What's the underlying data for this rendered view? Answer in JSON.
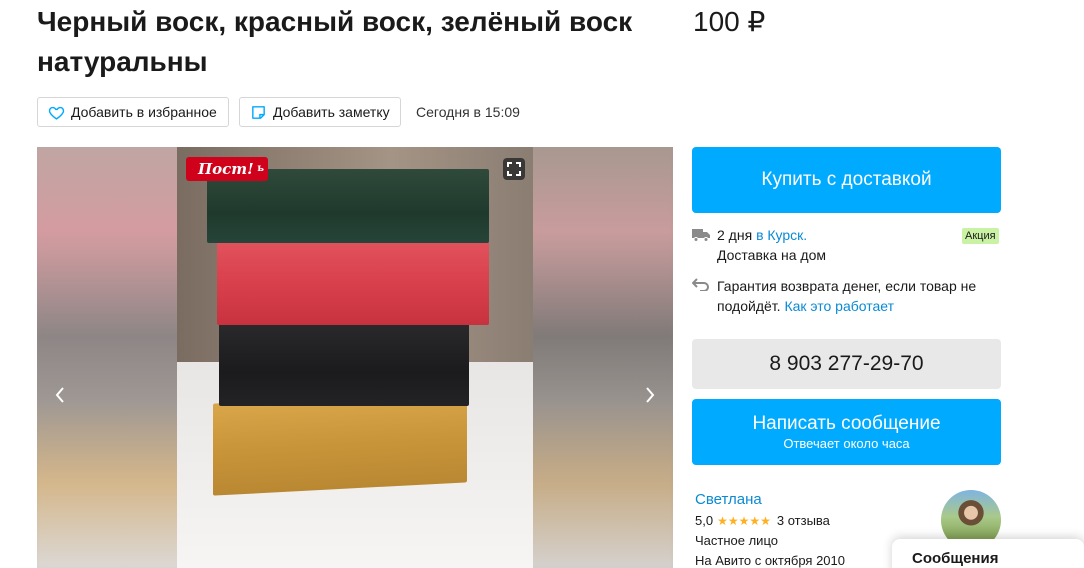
{
  "listing": {
    "title": "Черный воск, красный воск, зелёный воск натуральны",
    "price": "100 ₽"
  },
  "actions": {
    "favorite_label": "Добавить в избранное",
    "note_label": "Добавить заметку",
    "published": "Сегодня в 15:09"
  },
  "gallery": {
    "badge": "Пост!",
    "badge_suffix": "ь"
  },
  "purchase": {
    "buy_label": "Купить с доставкой",
    "delivery_days": "2 дня",
    "delivery_city": "в Курск.",
    "promo_badge": "Акция",
    "delivery_home": "Доставка на дом",
    "guarantee_text": "Гарантия возврата денег, если товар не подойдёт.",
    "guarantee_link": "Как это работает"
  },
  "contact": {
    "phone": "8 903 277-29-70",
    "message_label": "Написать сообщение",
    "message_sub": "Отвечает около часа"
  },
  "seller": {
    "name": "Светлана",
    "rating": "5,0",
    "stars": "★★★★★",
    "reviews": "3 отзыва",
    "type": "Частное лицо",
    "since": "На Авито с октября 2010"
  },
  "messages_panel": {
    "label": "Сообщения"
  },
  "colors": {
    "accent": "#00aaff",
    "link": "#0a8ad4",
    "badge_red": "#d0021b",
    "promo_green": "#c9f2a5",
    "star": "#ffb021"
  }
}
